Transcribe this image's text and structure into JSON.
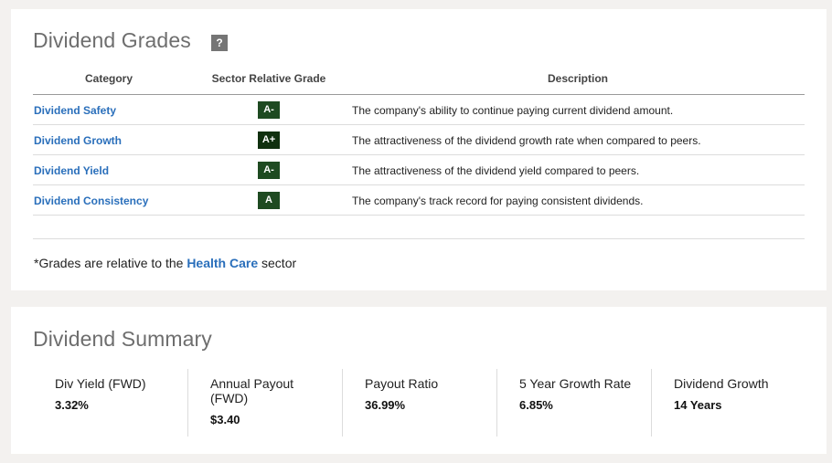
{
  "grades": {
    "title": "Dividend Grades",
    "help_icon": "?",
    "columns": [
      "Category",
      "Sector Relative Grade",
      "Description"
    ],
    "rows": [
      {
        "category": "Dividend Safety",
        "grade": "A-",
        "description": "The company's ability to continue paying current dividend amount."
      },
      {
        "category": "Dividend Growth",
        "grade": "A+",
        "description": "The attractiveness of the dividend growth rate when compared to peers."
      },
      {
        "category": "Dividend Yield",
        "grade": "A-",
        "description": "The attractiveness of the dividend yield compared to peers."
      },
      {
        "category": "Dividend Consistency",
        "grade": "A",
        "description": "The company's track record for paying consistent dividends."
      }
    ],
    "footnote_prefix": "*Grades are relative to the ",
    "footnote_sector": "Health Care",
    "footnote_suffix": " sector",
    "colors": {
      "link": "#2a6fbb",
      "grade_badge": "#1e4a21",
      "grade_badge_aplus": "#10300f"
    }
  },
  "summary": {
    "title": "Dividend Summary",
    "metrics": [
      {
        "label": "Div Yield (FWD)",
        "value": "3.32%"
      },
      {
        "label": "Annual Payout (FWD)",
        "value": "$3.40"
      },
      {
        "label": "Payout Ratio",
        "value": "36.99%"
      },
      {
        "label": "5 Year Growth Rate",
        "value": "6.85%"
      },
      {
        "label": "Dividend Growth",
        "value": "14 Years"
      }
    ]
  }
}
